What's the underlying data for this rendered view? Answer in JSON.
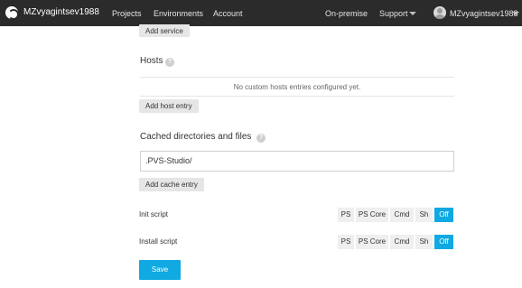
{
  "topbar": {
    "brand": "MZvyagintsev1988",
    "nav": [
      "Projects",
      "Environments",
      "Account"
    ],
    "on_premise": "On-premise",
    "support": "Support",
    "user": "MZvyagintsev1988"
  },
  "services": {
    "add_service_label": "Add service"
  },
  "hosts": {
    "title": "Hosts",
    "empty_text": "No custom hosts entries configured yet.",
    "add_label": "Add host entry"
  },
  "cache": {
    "title": "Cached directories and files",
    "value": ".PVS-Studio/",
    "add_label": "Add cache entry"
  },
  "init_script": {
    "label": "Init script",
    "options": [
      "PS",
      "PS Core",
      "Cmd",
      "Sh",
      "Off"
    ],
    "selected": "Off"
  },
  "install_script": {
    "label": "Install script",
    "options": [
      "PS",
      "PS Core",
      "Cmd",
      "Sh",
      "Off"
    ],
    "selected": "Off"
  },
  "save_label": "Save",
  "help_glyph": "?",
  "colors": {
    "topbar": "#2b2b2b",
    "accent": "#10a9e2"
  }
}
